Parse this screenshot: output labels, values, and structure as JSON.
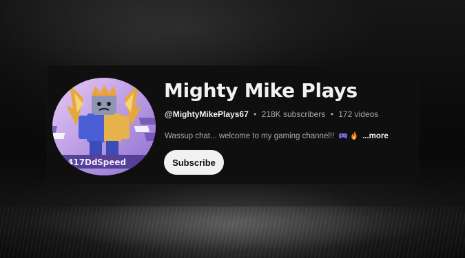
{
  "channel": {
    "name": "Mighty Mike Plays",
    "handle": "@MightyMikePlays67",
    "separator": "•",
    "subscribers": "218K subscribers",
    "videos": "172 videos",
    "description": "Wassup chat... welcome to my gaming channel!!",
    "more_label": "...more",
    "subscribe_label": "Subscribe",
    "avatar_sign_text": "Speed",
    "avatar_sign_number": "417Dd"
  },
  "icons": {
    "description_emoji_1": "game-controller-icon",
    "description_emoji_2": "fire-icon"
  },
  "colors": {
    "card_background": "#0f0f0f",
    "primary_text": "#f1f1f1",
    "secondary_text": "#aaaaaa",
    "subscribe_background": "#f1f1f1",
    "subscribe_text": "#0f0f0f",
    "avatar_background": "#b497e0"
  }
}
